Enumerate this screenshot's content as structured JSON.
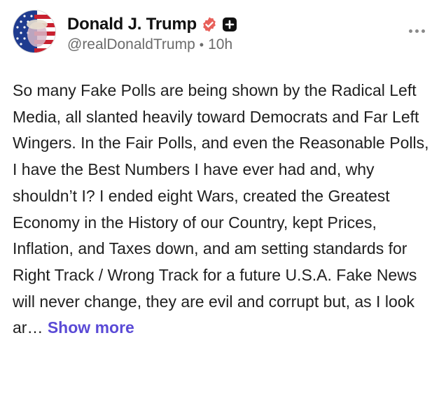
{
  "author": {
    "display_name": "Donald J. Trump",
    "handle": "@realDonaldTrump",
    "time_ago": "10h",
    "separator": "•",
    "verified_icon": "verified-badge-icon",
    "extra_badge_icon": "plus-badge-icon"
  },
  "post": {
    "text": "So many Fake Polls are being shown by the Radical Left Media, all slanted heavily toward Democrats and Far Left Wingers. In the Fair Polls, and even the Reasonable Polls, I have the Best Numbers I have ever had and, why shouldn’t I? I ended eight Wars, created the Greatest Economy in the History of our Country, kept Prices, Inflation, and Taxes down, and am setting standards for Right Track / Wrong Track for a future U.S.A. Fake News will never change, they are evil and corrupt but, as I look ar…",
    "show_more_label": "Show more"
  },
  "colors": {
    "accent": "#5a4ad6",
    "verified": "#e8615b",
    "muted": "#6b6b6b"
  }
}
